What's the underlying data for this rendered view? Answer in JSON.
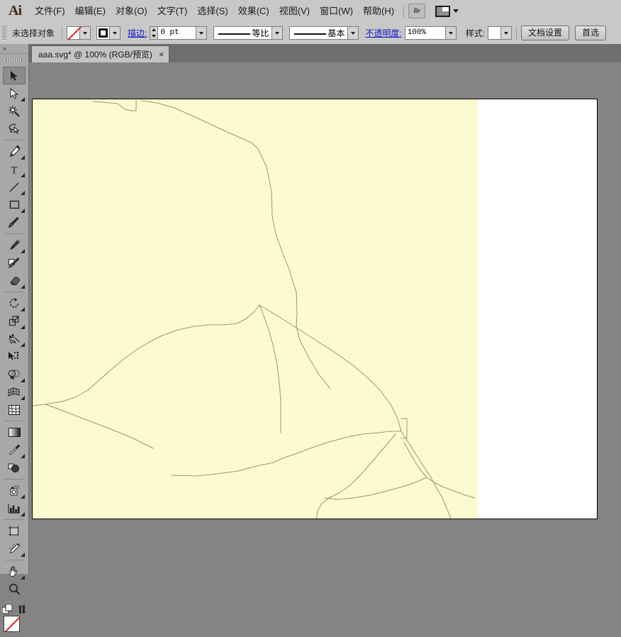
{
  "app": {
    "name": "Adobe Illustrator",
    "logo": "Ai"
  },
  "menubar": {
    "items": [
      {
        "label": "文件(F)",
        "name": "menu-file"
      },
      {
        "label": "编辑(E)",
        "name": "menu-edit"
      },
      {
        "label": "对象(O)",
        "name": "menu-object"
      },
      {
        "label": "文字(T)",
        "name": "menu-type"
      },
      {
        "label": "选择(S)",
        "name": "menu-select"
      },
      {
        "label": "效果(C)",
        "name": "menu-effect"
      },
      {
        "label": "视图(V)",
        "name": "menu-view"
      },
      {
        "label": "窗口(W)",
        "name": "menu-window"
      },
      {
        "label": "帮助(H)",
        "name": "menu-help"
      }
    ],
    "bridge_button": "Br",
    "workspace_switcher": "workspace-switcher-icon"
  },
  "controlbar": {
    "selection_status": "未选择对象",
    "fill_swatch": "none",
    "stroke_swatch": "black-stroke",
    "stroke_label": "描边:",
    "stroke_weight": "0 pt",
    "stroke_profile": "等比",
    "brush_definition": "基本",
    "opacity_label": "不透明度:",
    "opacity_value": "100%",
    "style_label": "样式:",
    "document_setup_button": "文档设置",
    "preferences_button": "首选"
  },
  "tabbar": {
    "tabs": [
      {
        "title": "aaa.svg* @ 100% (RGB/预览)",
        "close": "×",
        "active": true
      }
    ]
  },
  "toolbar": {
    "collapse": "»",
    "tools": [
      {
        "name": "selection-tool",
        "glyph": "arrow-solid",
        "active": true,
        "flyout": false
      },
      {
        "name": "direct-selection-tool",
        "glyph": "arrow-hollow",
        "active": false,
        "flyout": true
      },
      {
        "name": "magic-wand-tool",
        "glyph": "magic-wand",
        "active": false,
        "flyout": false
      },
      {
        "name": "lasso-tool",
        "glyph": "lasso",
        "active": false,
        "flyout": false
      },
      {
        "name": "pen-tool",
        "glyph": "pen",
        "active": false,
        "flyout": true
      },
      {
        "name": "type-tool",
        "glyph": "type-T",
        "active": false,
        "flyout": true
      },
      {
        "name": "line-segment-tool",
        "glyph": "line",
        "active": false,
        "flyout": true
      },
      {
        "name": "rectangle-tool",
        "glyph": "rectangle",
        "active": false,
        "flyout": true
      },
      {
        "name": "paintbrush-tool",
        "glyph": "paintbrush",
        "active": false,
        "flyout": false
      },
      {
        "name": "pencil-tool",
        "glyph": "pencil",
        "active": false,
        "flyout": true
      },
      {
        "name": "blob-brush-tool",
        "glyph": "blob-brush",
        "active": false,
        "flyout": false
      },
      {
        "name": "eraser-tool",
        "glyph": "eraser",
        "active": false,
        "flyout": true
      },
      {
        "name": "rotate-tool",
        "glyph": "rotate",
        "active": false,
        "flyout": true
      },
      {
        "name": "scale-tool",
        "glyph": "scale",
        "active": false,
        "flyout": true
      },
      {
        "name": "width-tool",
        "glyph": "width-warp",
        "active": false,
        "flyout": true
      },
      {
        "name": "free-transform-tool",
        "glyph": "free-transform",
        "active": false,
        "flyout": false
      },
      {
        "name": "shape-builder-tool",
        "glyph": "shape-builder",
        "active": false,
        "flyout": true
      },
      {
        "name": "perspective-grid-tool",
        "glyph": "perspective-grid",
        "active": false,
        "flyout": true
      },
      {
        "name": "mesh-tool",
        "glyph": "mesh",
        "active": false,
        "flyout": false
      },
      {
        "name": "gradient-tool",
        "glyph": "gradient",
        "active": false,
        "flyout": false
      },
      {
        "name": "eyedropper-tool",
        "glyph": "eyedropper",
        "active": false,
        "flyout": true
      },
      {
        "name": "blend-tool",
        "glyph": "blend",
        "active": false,
        "flyout": false
      },
      {
        "name": "symbol-sprayer-tool",
        "glyph": "symbol-sprayer",
        "active": false,
        "flyout": true
      },
      {
        "name": "column-graph-tool",
        "glyph": "column-graph",
        "active": false,
        "flyout": true
      },
      {
        "name": "artboard-tool",
        "glyph": "artboard",
        "active": false,
        "flyout": false
      },
      {
        "name": "slice-tool",
        "glyph": "slice",
        "active": false,
        "flyout": true
      },
      {
        "name": "hand-tool",
        "glyph": "hand",
        "active": false,
        "flyout": true
      },
      {
        "name": "zoom-tool",
        "glyph": "magnifier",
        "active": false,
        "flyout": false
      }
    ],
    "fill_stroke_swatch": "none",
    "swap_icon": "swap-fill-stroke-icon",
    "default_icon": "default-fill-stroke-icon"
  },
  "canvas": {
    "document_name": "aaa.svg",
    "zoom": "100%",
    "color_mode": "RGB",
    "view_mode": "预览",
    "artwork": {
      "description": "vector-line-map-region",
      "fill_color": "#fcfbcf",
      "stroke_color": "#9a9470",
      "background_color": "#ffffff",
      "pasteboard_color": "#848484"
    }
  }
}
